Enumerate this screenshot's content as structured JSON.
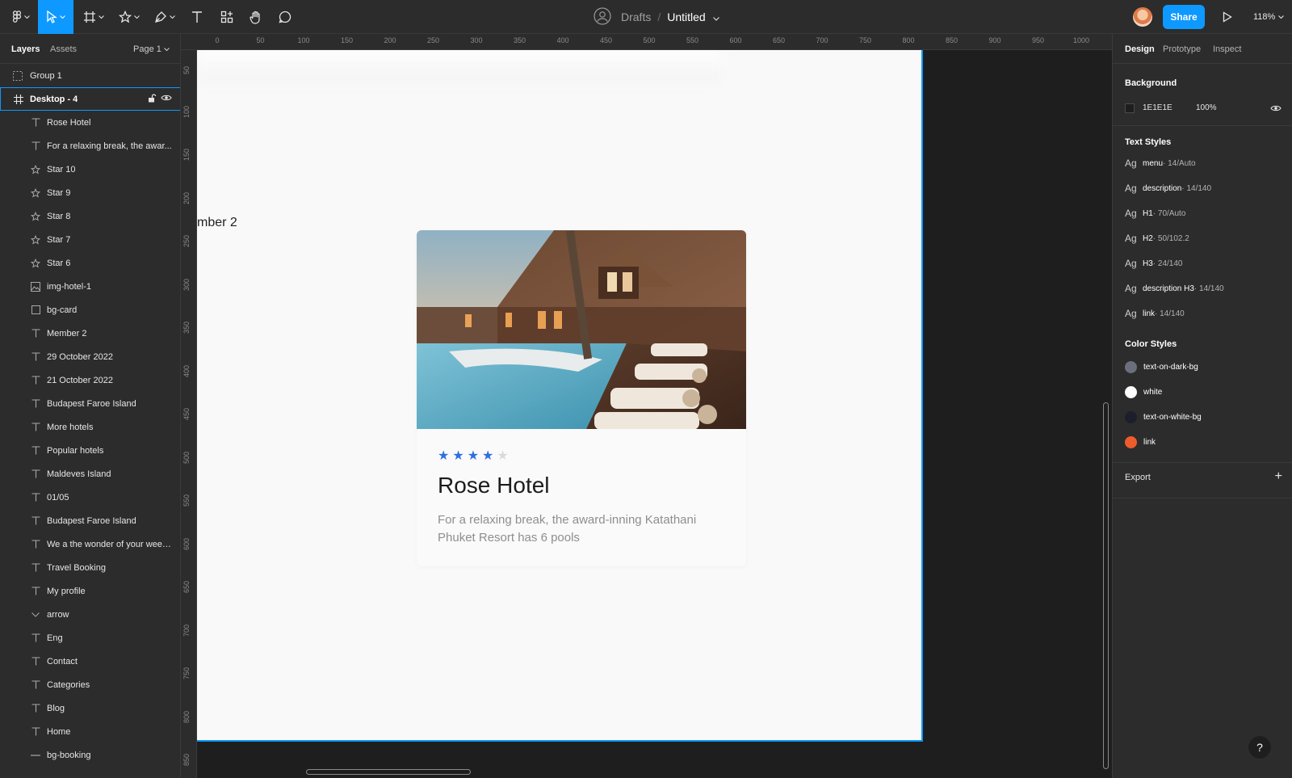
{
  "toolbar": {
    "breadcrumb_folder": "Drafts",
    "breadcrumb_sep": "/",
    "file_title": "Untitled",
    "share_label": "Share",
    "zoom": "118%"
  },
  "left_panel": {
    "tab_layers": "Layers",
    "tab_assets": "Assets",
    "page": "Page 1",
    "group_label": "Group 1",
    "frame_label": "Desktop - 4",
    "layers": [
      {
        "label": "Rose Hotel",
        "icon": "text-icon"
      },
      {
        "label": "For a relaxing break, the awar...",
        "icon": "text-icon"
      },
      {
        "label": "Star 10",
        "icon": "star-icon"
      },
      {
        "label": "Star 9",
        "icon": "star-icon"
      },
      {
        "label": "Star 8",
        "icon": "star-icon"
      },
      {
        "label": "Star 7",
        "icon": "star-icon"
      },
      {
        "label": "Star 6",
        "icon": "star-icon"
      },
      {
        "label": "img-hotel-1",
        "icon": "image-icon"
      },
      {
        "label": "bg-card",
        "icon": "rectangle-icon"
      },
      {
        "label": "Member 2",
        "icon": "text-icon"
      },
      {
        "label": "29 October 2022",
        "icon": "text-icon"
      },
      {
        "label": "21 October 2022",
        "icon": "text-icon"
      },
      {
        "label": "Budapest Faroe Island",
        "icon": "text-icon"
      },
      {
        "label": "More hotels",
        "icon": "text-icon"
      },
      {
        "label": "Popular hotels",
        "icon": "text-icon"
      },
      {
        "label": "Maldeves Island",
        "icon": "text-icon"
      },
      {
        "label": "01/05",
        "icon": "text-icon"
      },
      {
        "label": "Budapest Faroe Island",
        "icon": "text-icon"
      },
      {
        "label": "We a the wonder of your week...",
        "icon": "text-icon"
      },
      {
        "label": "Travel Booking",
        "icon": "text-icon"
      },
      {
        "label": "My profile",
        "icon": "text-icon"
      },
      {
        "label": "arrow",
        "icon": "vector-icon"
      },
      {
        "label": "Eng",
        "icon": "text-icon"
      },
      {
        "label": "Contact",
        "icon": "text-icon"
      },
      {
        "label": "Categories",
        "icon": "text-icon"
      },
      {
        "label": "Blog",
        "icon": "text-icon"
      },
      {
        "label": "Home",
        "icon": "text-icon"
      },
      {
        "label": "bg-booking",
        "icon": "line-icon"
      }
    ]
  },
  "rulers": {
    "top": [
      "0",
      "50",
      "100",
      "150",
      "200",
      "250",
      "300",
      "350",
      "400",
      "450",
      "500",
      "550",
      "600",
      "650",
      "700",
      "750",
      "800",
      "850",
      "900",
      "950",
      "1000"
    ],
    "left": [
      "50",
      "100",
      "150",
      "200",
      "250",
      "300",
      "350",
      "400",
      "450",
      "500",
      "550",
      "600",
      "650",
      "700",
      "750",
      "800",
      "850"
    ]
  },
  "canvas": {
    "partial_text": "mber 2",
    "card": {
      "rating": 4,
      "max_rating": 5,
      "title": "Rose Hotel",
      "description": "For a relaxing break, the award-inning Katathani Phuket Resort has 6 pools"
    }
  },
  "right_panel": {
    "tab_design": "Design",
    "tab_prototype": "Prototype",
    "tab_inspect": "Inspect",
    "background_head": "Background",
    "background_hex": "1E1E1E",
    "background_opacity": "100%",
    "text_styles_head": "Text Styles",
    "text_styles": [
      {
        "ag": "Ag",
        "name": "menu",
        "meta": " · 14/Auto"
      },
      {
        "ag": "Ag",
        "name": "description",
        "meta": " · 14/140"
      },
      {
        "ag": "Ag",
        "name": "H1",
        "meta": " · 70/Auto"
      },
      {
        "ag": "Ag",
        "name": "H2",
        "meta": " · 50/102.2"
      },
      {
        "ag": "Ag",
        "name": "H3",
        "meta": " · 24/140"
      },
      {
        "ag": "Ag",
        "name": "description H3",
        "meta": " · 14/140"
      },
      {
        "ag": "Ag",
        "name": "link",
        "meta": " · 14/140"
      }
    ],
    "color_styles_head": "Color Styles",
    "color_styles": [
      {
        "name": "text-on-dark-bg",
        "color": "#6b6f7d"
      },
      {
        "name": "white",
        "color": "#ffffff"
      },
      {
        "name": "text-on-white-bg",
        "color": "#1c1f2b"
      },
      {
        "name": "link",
        "color": "#ee5c2e"
      }
    ],
    "export_head": "Export",
    "help": "?"
  },
  "colors": {
    "accent": "#0d99ff",
    "panel": "#2c2c2c",
    "canvas": "#1e1e1e"
  }
}
